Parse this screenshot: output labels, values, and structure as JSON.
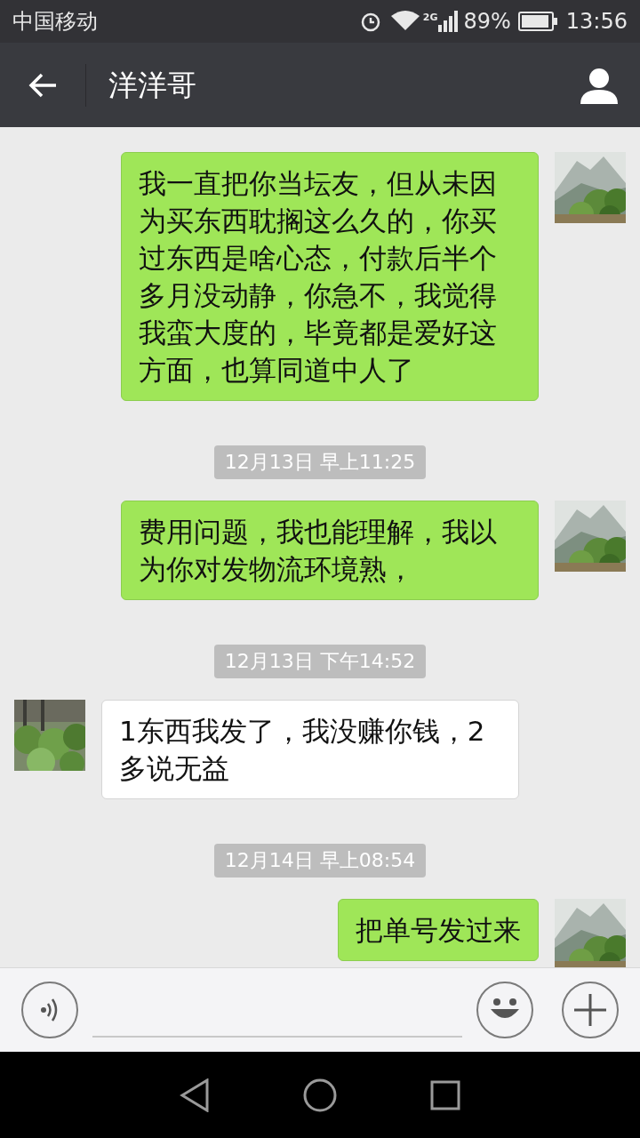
{
  "status_bar": {
    "carrier": "中国移动",
    "network": "2G",
    "battery": "89%",
    "time": "13:56"
  },
  "header": {
    "title": "洋洋哥"
  },
  "messages": [
    {
      "kind": "sent",
      "text": "我一直把你当坛友，但从未因为买东西耽搁这么久的，你买过东西是啥心态，付款后半个多月没动静，你急不，我觉得我蛮大度的，毕竟都是爱好这方面，也算同道中人了"
    },
    {
      "kind": "timestamp",
      "text": "12月13日 早上11:25"
    },
    {
      "kind": "sent",
      "text": "费用问题，我也能理解，我以为你对发物流环境熟，"
    },
    {
      "kind": "timestamp",
      "text": "12月13日 下午14:52"
    },
    {
      "kind": "received",
      "text": "1东西我发了，我没赚你钱，2多说无益"
    },
    {
      "kind": "timestamp",
      "text": "12月14日 早上08:54"
    },
    {
      "kind": "sent",
      "text": "把单号发过来"
    }
  ]
}
